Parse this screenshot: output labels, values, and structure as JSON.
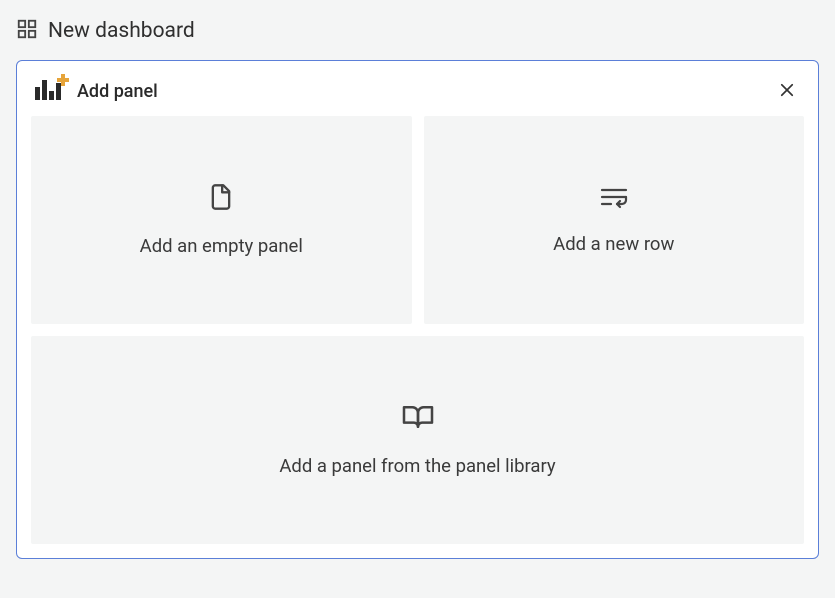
{
  "header": {
    "title": "New dashboard"
  },
  "addPanel": {
    "title": "Add panel",
    "options": {
      "emptyPanel": "Add an empty panel",
      "newRow": "Add a new row",
      "library": "Add a panel from the panel library"
    }
  }
}
